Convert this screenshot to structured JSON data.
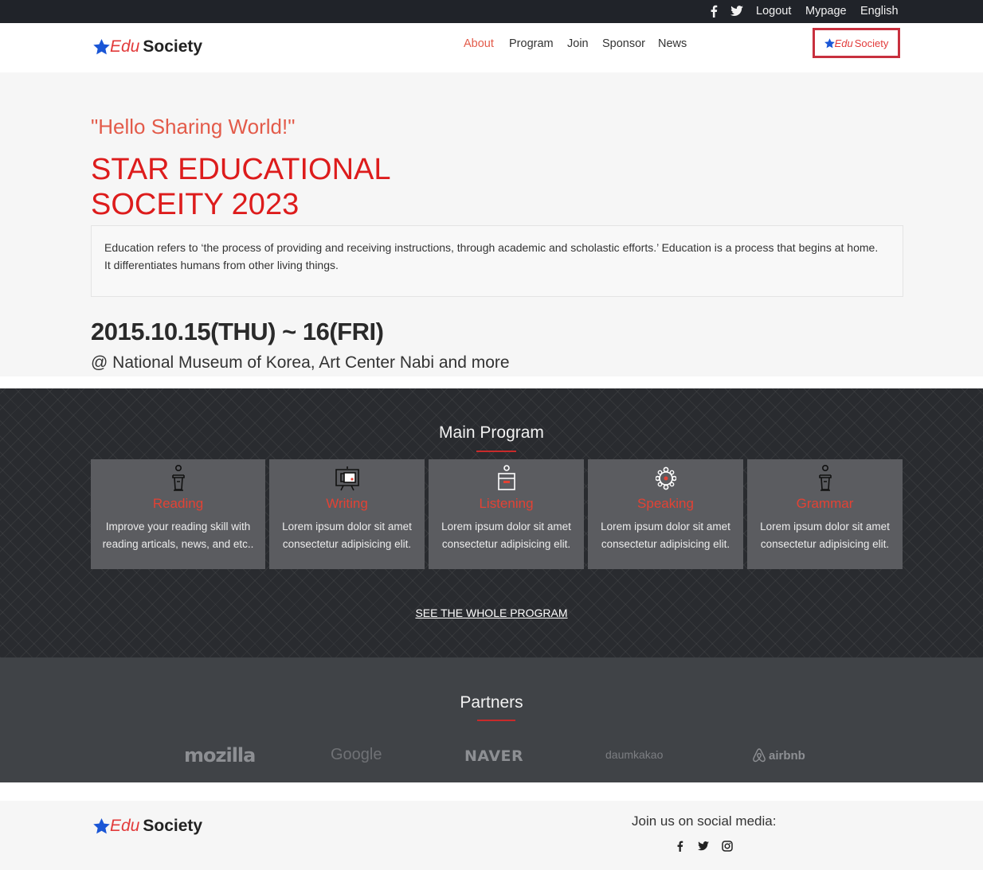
{
  "topbar": {
    "icons": [
      "facebook-icon",
      "twitter-icon"
    ],
    "links": [
      "Logout",
      "Mypage",
      "English"
    ]
  },
  "brand": {
    "edu": "Edu",
    "society": "Society"
  },
  "nav": [
    "About",
    "Program",
    "Join",
    "Sponsor",
    "News"
  ],
  "colors": {
    "accent": "#dd1c1c",
    "star": "#1a56d6",
    "topbar": "#202329",
    "program_bg": "#292b2f",
    "partners_bg": "#404347"
  },
  "hero": {
    "tagline": "\"Hello Sharing World!\"",
    "title_line1": "STAR EDUCATIONAL",
    "title_line2": "SOCEITY 2023",
    "description_line1": "Education refers to ‘the process of providing and receiving instructions, through academic and scholastic efforts.’ Education is a process that begins at home.",
    "description_line2": "It differentiates humans from other living things.",
    "date": "2015.10.15(THU) ~ 16(FRI)",
    "venue": "@ National Museum of Korea, Art Center Nabi and more"
  },
  "program": {
    "title": "Main Program",
    "cards": [
      {
        "title": "Reading",
        "line1": "Improve your reading skill with",
        "line2": "reading articals, news, and etc..",
        "icon": "podium-icon"
      },
      {
        "title": "Writing",
        "line1": "Lorem ipsum dolor sit amet",
        "line2": "consectetur adipisicing elit.",
        "icon": "presentation-board-icon"
      },
      {
        "title": "Listening",
        "line1": "Lorem ipsum dolor sit amet",
        "line2": "consectetur adipisicing elit.",
        "icon": "listening-box-icon"
      },
      {
        "title": "Speaking",
        "line1": "Lorem ipsum dolor sit amet",
        "line2": "consectetur adipisicing elit.",
        "icon": "network-icon"
      },
      {
        "title": "Grammar",
        "line1": "Lorem ipsum dolor sit amet",
        "line2": "consectetur adipisicing elit.",
        "icon": "podium-icon"
      }
    ],
    "see_all": "SEE THE WHOLE PROGRAM"
  },
  "partners": {
    "title": "Partners",
    "logos": [
      "mozilla",
      "Google",
      "NAVER",
      "daumkakao",
      "airbnb"
    ]
  },
  "footer": {
    "join": "Join us on social media:",
    "icons": [
      "facebook-icon",
      "twitter-icon",
      "instagram-icon"
    ]
  }
}
